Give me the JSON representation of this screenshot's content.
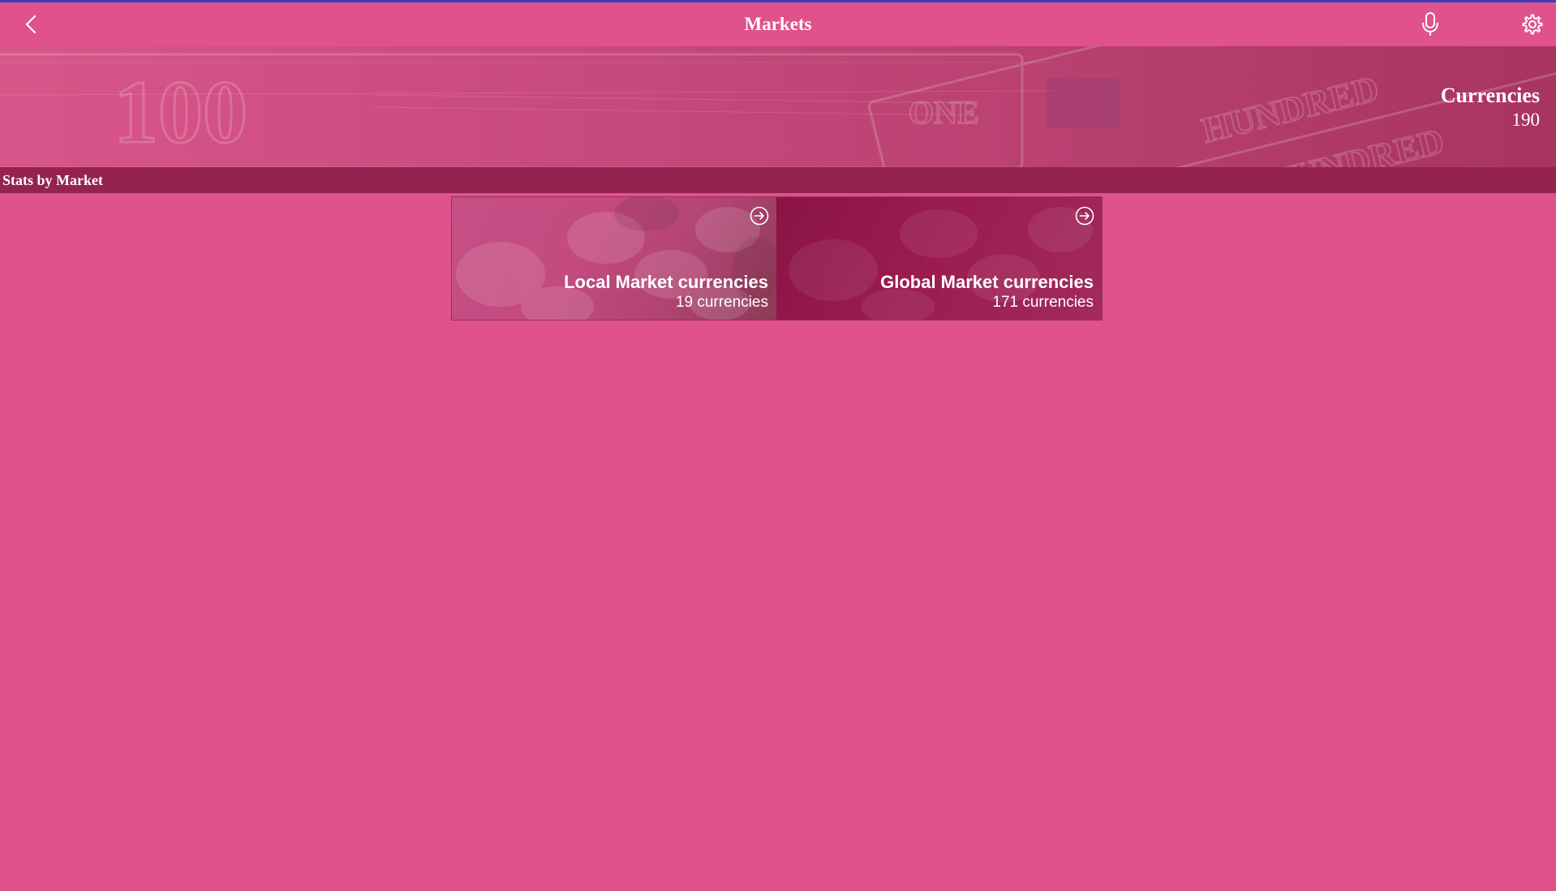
{
  "appbar": {
    "title": "Markets",
    "back_icon": "chevron-left-icon",
    "mic_icon": "microphone-icon",
    "settings_icon": "gear-icon"
  },
  "hero": {
    "title": "Currencies",
    "count": "190"
  },
  "section": {
    "title": "Stats by Market"
  },
  "tiles": [
    {
      "title": "Local Market currencies",
      "subtitle": "19 currencies",
      "icon": "arrow-right-circle-icon"
    },
    {
      "title": "Global Market currencies",
      "subtitle": "171 currencies",
      "icon": "arrow-right-circle-icon"
    }
  ],
  "colors": {
    "background": "#df528b",
    "section_bar": "#94234f",
    "top_line": "#3b3fb8",
    "text": "#ffffff"
  }
}
